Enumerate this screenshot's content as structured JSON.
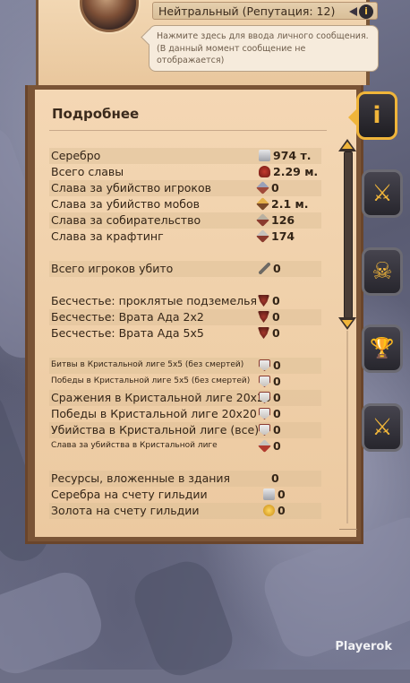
{
  "header": {
    "reputation": "Нейтральный (Репутация: 12)",
    "message_placeholder": "Нажмите здесь для ввода личного сообщения. (В данный момент сообщение не отображается)"
  },
  "panel": {
    "title": "Подробнее"
  },
  "stats": [
    {
      "label": "Серебро",
      "icon": "silver-icon",
      "value": "974 т."
    },
    {
      "label": "Всего славы",
      "icon": "fame-icon",
      "value": "2.29 м."
    },
    {
      "label": "Слава за убийство игроков",
      "icon": "pvp-fame-icon",
      "value": "0"
    },
    {
      "label": "Слава за убийство мобов",
      "icon": "pve-fame-icon",
      "value": "2.1 м."
    },
    {
      "label": "Слава за собирательство",
      "icon": "gathering-fame-icon",
      "value": "126"
    },
    {
      "label": "Слава за крафтинг",
      "icon": "crafting-fame-icon",
      "value": "174"
    },
    {
      "label": "Всего игроков убито",
      "icon": "sword-icon",
      "value": "0"
    },
    {
      "label": "Бесчестье: проклятые подземелья",
      "icon": "dishonor-icon",
      "value": "0"
    },
    {
      "label": "Бесчестье: Врата Ада 2x2",
      "icon": "dishonor-icon",
      "value": "0"
    },
    {
      "label": "Бесчестье: Врата Ада 5x5",
      "icon": "dishonor-icon",
      "value": "0"
    },
    {
      "label": "Битвы в Кристальной лиге 5x5 (без смертей)",
      "icon": "crystal-shield-icon",
      "value": "0"
    },
    {
      "label": "Победы в Кристальной лиге 5x5 (без смертей)",
      "icon": "crystal-shield-icon",
      "value": "0"
    },
    {
      "label": "Сражения в Кристальной лиге 20x20",
      "icon": "crystal-shield-icon",
      "value": "0"
    },
    {
      "label": "Победы в Кристальной лиге 20x20",
      "icon": "crystal-shield-icon",
      "value": "0"
    },
    {
      "label": "Убийства в Кристальной лиге (все)",
      "icon": "crystal-shield-icon",
      "value": "0"
    },
    {
      "label": "Слава за убийства в Кристальной лиге",
      "icon": "crystal-fame-icon",
      "value": "0"
    },
    {
      "label": "Ресурсы, вложенные в здания",
      "icon": "",
      "value": "0"
    },
    {
      "label": "Серебра на счету гильдии",
      "icon": "silver-icon",
      "value": "0"
    },
    {
      "label": "Золота на счету гильдии",
      "icon": "gold-icon",
      "value": "0"
    }
  ],
  "tabs": [
    {
      "name": "info",
      "glyph": "i"
    },
    {
      "name": "combat",
      "glyph": "⚔"
    },
    {
      "name": "pvp",
      "glyph": "☠"
    },
    {
      "name": "achievements",
      "glyph": "🏆"
    },
    {
      "name": "guild",
      "glyph": "⚔"
    }
  ],
  "watermark": "Playerok"
}
